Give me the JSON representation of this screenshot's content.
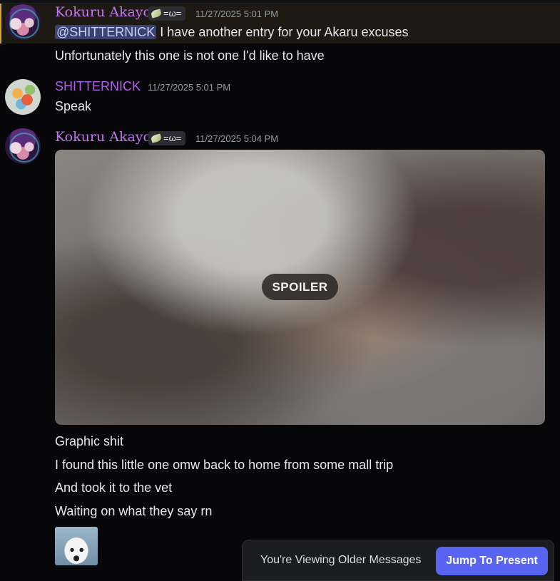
{
  "messages": [
    {
      "author": "Kokuru Akayo",
      "tag": "=ω=",
      "timestamp": "11/27/2025 5:01 PM",
      "mention": "@SHITTERNICK",
      "lines": [
        "I have another entry for your Akaru excuses",
        "Unfortunately this one is not one I'd like to have"
      ]
    },
    {
      "author": "SHITTERNICK",
      "timestamp": "11/27/2025 5:01 PM",
      "lines": [
        "Speak"
      ]
    },
    {
      "author": "Kokuru Akayo",
      "tag": "=ω=",
      "timestamp": "11/27/2025 5:04 PM",
      "spoiler_label": "SPOILER",
      "lines": [
        "Graphic shit",
        "I found this little one omw back to home from some mall trip",
        "And took it to the vet",
        "Waiting on what they say rn"
      ]
    }
  ],
  "older_bar": {
    "text": "You're Viewing Older Messages",
    "jump_label": "Jump To Present"
  },
  "colors": {
    "accent": "#5865f2",
    "username_kokuru": "#c276f3",
    "username_nick": "#b45cf2",
    "mention_bg": "#3c4270",
    "highlight_border": "#d9a53b"
  }
}
